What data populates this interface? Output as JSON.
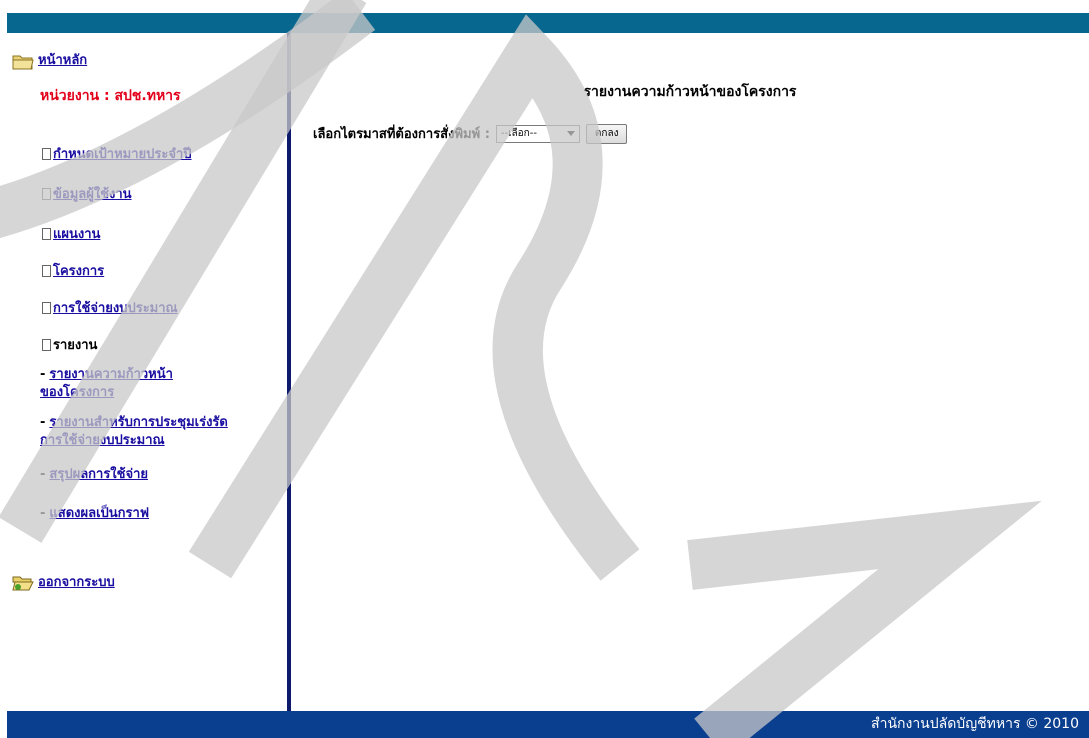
{
  "sidebar": {
    "home_label": "หน้าหลัก",
    "unit_label": "หน่วยงาน : สปช.ทหาร",
    "items": [
      {
        "label": "กำหนดเป้าหมายประจำปี"
      },
      {
        "label": "ข้อมูลผู้ใช้งาน"
      },
      {
        "label": "แผนงาน"
      },
      {
        "label": "โครงการ"
      },
      {
        "label": "การใช้จ่ายงบประมาณ"
      },
      {
        "label": "รายงาน"
      }
    ],
    "report_sub": [
      {
        "line1": "รายงานความก้าวหน้า",
        "line2": "ของโครงการ"
      },
      {
        "line1": "รายงานสำหรับการประชุมเร่งรัด",
        "line2": "การใช้จ่ายงบประมาณ"
      },
      {
        "line1": "สรุปผลการใช้จ่าย"
      },
      {
        "line1": "แสดงผลเป็นกราฟ"
      }
    ],
    "logout_label": "ออกจากระบบ"
  },
  "main": {
    "title": "รายงานความก้าวหน้าของโครงการ",
    "form_label": "เลือกไตรมาสที่ต้องการสั่งพิมพ์ :",
    "select_value": "--เลือก--",
    "ok_label": "ตกลง"
  },
  "footer": {
    "text": "สำนักงานปลัดบัญชีทหาร © 2010"
  },
  "colors": {
    "top_bar": "#08678f",
    "footer": "#0a3e8f",
    "divider": "#0e1a6c",
    "link": "#1a0fa0",
    "unit": "#e3001b"
  }
}
